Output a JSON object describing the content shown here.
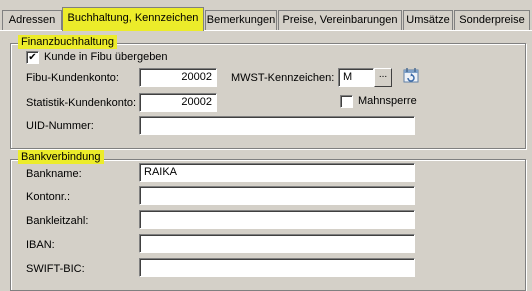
{
  "tabs": [
    {
      "label": "Adressen"
    },
    {
      "label": "Buchhaltung, Kennzeichen"
    },
    {
      "label": "Bemerkungen"
    },
    {
      "label": "Preise, Vereinbarungen"
    },
    {
      "label": "Umsätze"
    },
    {
      "label": "Sonderpreise"
    }
  ],
  "colors": {
    "highlight": "#ecec2a",
    "background": "#d4d0c8"
  },
  "finanz": {
    "title": "Finanzbuchhaltung",
    "kunde_fibu_label": "Kunde in Fibu übergeben",
    "kunde_fibu_checked": true,
    "fibu_label": "Fibu-Kundenkonto:",
    "fibu_value": "20002",
    "statistik_label": "Statistik-Kundenkonto:",
    "statistik_value": "20002",
    "uid_label": "UID-Nummer:",
    "uid_value": "",
    "mwst_label": "MWST-Kennzeichen:",
    "mwst_value": "M",
    "mwst_button": "...",
    "calendar_icon": "calendar-refresh-icon",
    "mahnsperre_label": "Mahnsperre",
    "mahnsperre_checked": false
  },
  "bank": {
    "title": "Bankverbindung",
    "bankname_label": "Bankname:",
    "bankname_value": "RAIKA",
    "kontonr_label": "Kontonr.:",
    "kontonr_value": "",
    "bankleitzahl_label": "Bankleitzahl:",
    "bankleitzahl_value": "",
    "iban_label": "IBAN:",
    "iban_value": "",
    "swift_label": "SWIFT-BIC:",
    "swift_value": ""
  }
}
